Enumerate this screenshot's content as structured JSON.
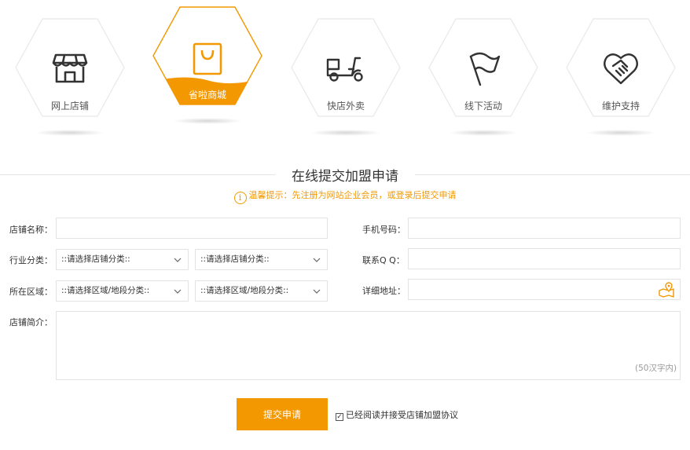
{
  "categories": [
    {
      "label": "网上店铺",
      "icon": "storefront-icon",
      "active": false
    },
    {
      "label": "省啦商城",
      "icon": "shopping-bag-icon",
      "active": true
    },
    {
      "label": "快店外卖",
      "icon": "delivery-scooter-icon",
      "active": false
    },
    {
      "label": "线下活动",
      "icon": "flag-icon",
      "active": false
    },
    {
      "label": "维护支持",
      "icon": "handshake-heart-icon",
      "active": false
    }
  ],
  "colors": {
    "accent": "#f39800",
    "border": "#e3e3e3",
    "hex_border": "#e8e8e8",
    "icon": "#333333"
  },
  "form": {
    "title": "在线提交加盟申请",
    "notice": "温馨提示：先注册为网站企业会员，或登录后提交申请",
    "store_name_label": "店铺名称：",
    "phone_label": "手机号码：",
    "industry_label": "行业分类：",
    "industry_select_1": "::请选择店铺分类::",
    "industry_select_2": "::请选择店铺分类::",
    "qq_label": "联系Q Q：",
    "region_label": "所在区域：",
    "region_select_1": "::请选择区域/地段分类::",
    "region_select_2": "::请选择区域/地段分类::",
    "address_label": "详细地址：",
    "intro_label": "店铺简介：",
    "intro_counter": "(50汉字内)",
    "submit_label": "提交申请",
    "agree_label": "已经阅读并接受店铺加盟协议"
  }
}
